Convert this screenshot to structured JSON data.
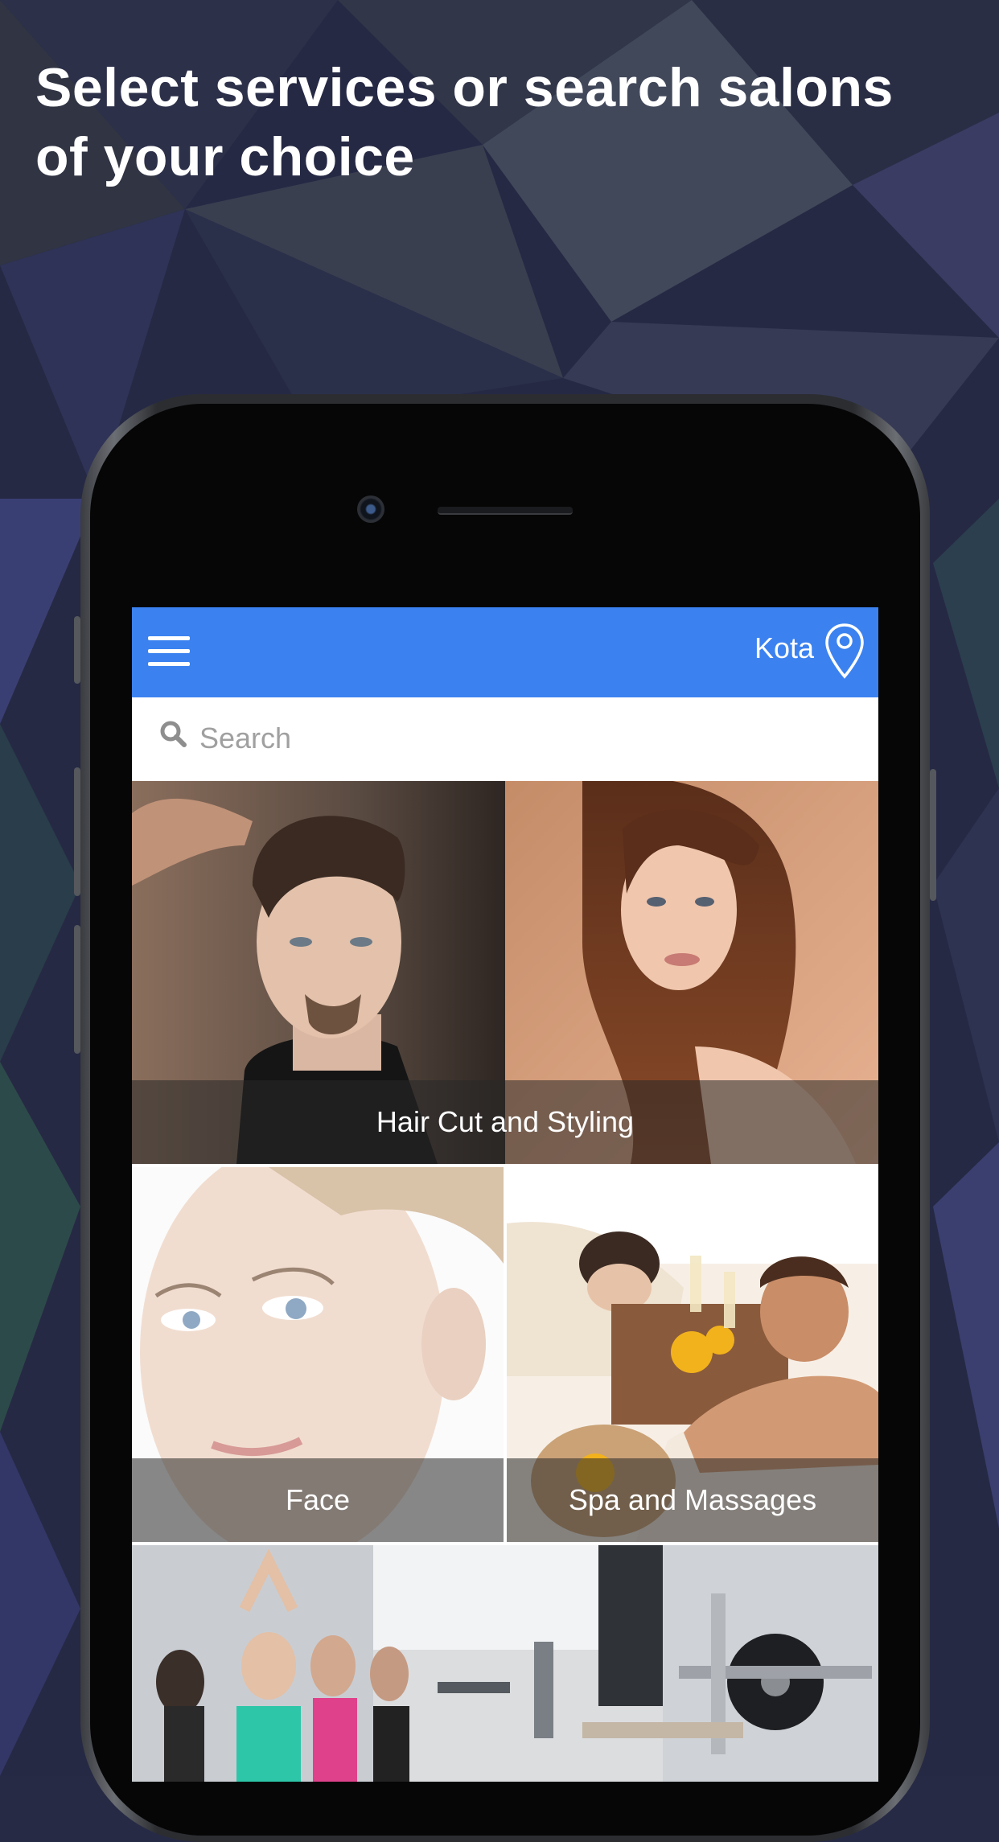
{
  "headline": "Select services or search salons of your choice",
  "app_bar": {
    "city": "Kota",
    "menu_icon": "hamburger-menu-icon",
    "location_icon": "location-pin-icon"
  },
  "search": {
    "placeholder": "Search",
    "icon": "search-icon"
  },
  "categories": [
    {
      "label": "Hair Cut and Styling"
    },
    {
      "label": "Face"
    },
    {
      "label": "Spa and Massages"
    },
    {
      "label": ""
    }
  ],
  "colors": {
    "app_bar": "#3b82f0",
    "background": "#272a45",
    "caption_overlay": "rgba(40,40,40,0.55)"
  }
}
